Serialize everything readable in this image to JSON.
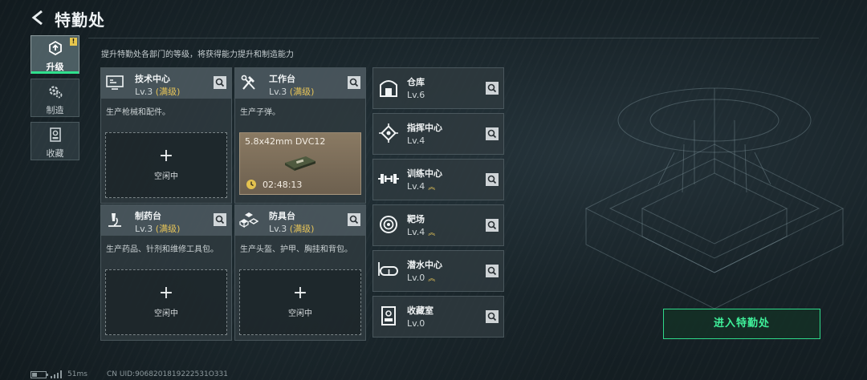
{
  "header": {
    "title": "特勤处"
  },
  "tabs": [
    {
      "label": "升级",
      "icon": "upgrade-icon",
      "badge": "!",
      "active": true
    },
    {
      "label": "制造",
      "icon": "gear-icon",
      "active": false
    },
    {
      "label": "收藏",
      "icon": "collection-icon",
      "active": false
    }
  ],
  "subtitle": "提升特勤处各部门的等级，将获得能力提升和制造能力",
  "cards": [
    {
      "name": "技术中心",
      "level": "Lv.3",
      "maxed": "(满级)",
      "desc": "生产枪械和配件。",
      "slot_plus": "+",
      "slot_label": "空闲中",
      "icon": "monitor-icon"
    },
    {
      "name": "工作台",
      "level": "Lv.3",
      "maxed": "(满级)",
      "desc": "生产子弹。",
      "icon": "tools-icon",
      "production": {
        "item": "5.8x42mm DVC12",
        "time": "02:48:13",
        "icon": "ammo-box-icon"
      }
    },
    {
      "name": "制药台",
      "level": "Lv.3",
      "maxed": "(满级)",
      "desc": "生产药品、针剂和维修工具包。",
      "slot_plus": "+",
      "slot_label": "空闲中",
      "icon": "microscope-icon"
    },
    {
      "name": "防具台",
      "level": "Lv.3",
      "maxed": "(满级)",
      "desc": "生产头盔、护甲、胸挂和背包。",
      "slot_plus": "+",
      "slot_label": "空闲中",
      "icon": "armor-blocks-icon"
    }
  ],
  "rooms": [
    {
      "name": "仓库",
      "level": "Lv.6",
      "upgradable": false,
      "icon": "warehouse-icon"
    },
    {
      "name": "指挥中心",
      "level": "Lv.4",
      "upgradable": false,
      "icon": "chip-icon"
    },
    {
      "name": "训练中心",
      "level": "Lv.4",
      "upgradable": true,
      "icon": "dumbbell-icon"
    },
    {
      "name": "靶场",
      "level": "Lv.4",
      "upgradable": true,
      "icon": "target-icon"
    },
    {
      "name": "潜水中心",
      "level": "Lv.0",
      "upgradable": true,
      "icon": "diving-mask-icon"
    },
    {
      "name": "收藏室",
      "level": "Lv.0",
      "upgradable": false,
      "icon": "display-case-icon"
    }
  ],
  "upgrade_marker": "︽",
  "enter_button": "进入特勤处",
  "footer": {
    "ping": "51ms",
    "uid": "CN UID:9068201819222531O331"
  },
  "colors": {
    "accent_green": "#2fd98a",
    "maxed_gold": "#e6c458",
    "badge_yellow": "#e7c64d"
  }
}
